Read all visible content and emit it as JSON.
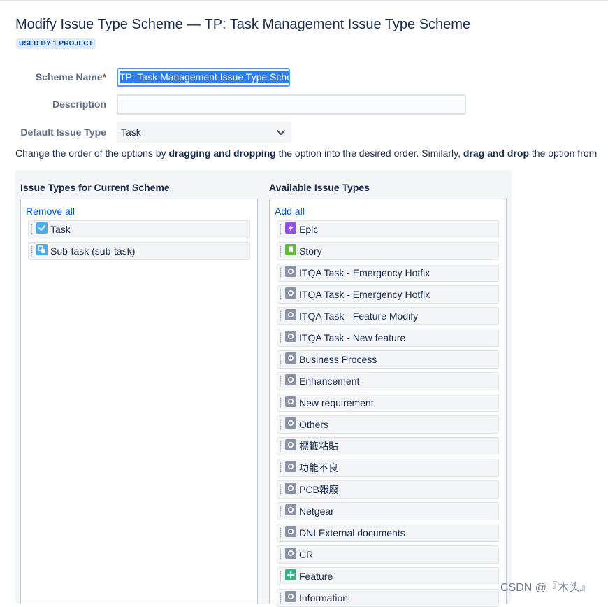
{
  "header": {
    "title": "Modify Issue Type Scheme — TP: Task Management Issue Type Scheme",
    "badge": "USED BY 1 PROJECT"
  },
  "form": {
    "scheme_name_label": "Scheme Name",
    "required_marker": "*",
    "scheme_name_value": "TP: Task Management Issue Type Scher",
    "description_label": "Description",
    "description_value": "",
    "default_issue_type_label": "Default Issue Type",
    "default_issue_type_value": "Task"
  },
  "help": {
    "t1": "Change the order of the options by ",
    "b1": "dragging and dropping",
    "t2": " the option into the desired order. Similarly, ",
    "b2": "drag and drop",
    "t3": " the option from"
  },
  "current": {
    "heading": "Issue Types for Current Scheme",
    "action": "Remove all",
    "items": [
      {
        "label": "Task",
        "icon": "task-icon",
        "color": "#4bade8"
      },
      {
        "label": "Sub-task (sub-task)",
        "icon": "subtask-icon",
        "color": "#4bade8"
      }
    ]
  },
  "available": {
    "heading": "Available Issue Types",
    "action": "Add all",
    "items": [
      {
        "label": "Epic",
        "icon": "epic-icon",
        "color": "#904ee2"
      },
      {
        "label": "Story",
        "icon": "story-icon",
        "color": "#63ba3c"
      },
      {
        "label": "ITQA Task - Emergency Hotfix",
        "icon": "generic-issue-icon",
        "color": "#8993a4"
      },
      {
        "label": "ITQA Task - Emergency Hotfix",
        "icon": "generic-issue-icon",
        "color": "#8993a4"
      },
      {
        "label": "ITQA Task - Feature Modify",
        "icon": "generic-issue-icon",
        "color": "#8993a4"
      },
      {
        "label": "ITQA Task - New feature",
        "icon": "generic-issue-icon",
        "color": "#8993a4"
      },
      {
        "label": "Business Process",
        "icon": "generic-issue-icon",
        "color": "#8993a4"
      },
      {
        "label": "Enhancement",
        "icon": "generic-issue-icon",
        "color": "#8993a4"
      },
      {
        "label": "New requirement",
        "icon": "generic-issue-icon",
        "color": "#8993a4"
      },
      {
        "label": "Others",
        "icon": "generic-issue-icon",
        "color": "#8993a4"
      },
      {
        "label": "標籤粘貼",
        "icon": "generic-issue-icon",
        "color": "#8993a4"
      },
      {
        "label": "功能不良",
        "icon": "generic-issue-icon",
        "color": "#8993a4"
      },
      {
        "label": "PCB報廢",
        "icon": "generic-issue-icon",
        "color": "#8993a4"
      },
      {
        "label": "Netgear",
        "icon": "generic-issue-icon",
        "color": "#8993a4"
      },
      {
        "label": "DNI External documents",
        "icon": "generic-issue-icon",
        "color": "#8993a4"
      },
      {
        "label": "CR",
        "icon": "generic-issue-icon",
        "color": "#8993a4"
      },
      {
        "label": "Feature",
        "icon": "new-feature-icon",
        "color": "#36b37e"
      },
      {
        "label": "Information",
        "icon": "generic-issue-icon",
        "color": "#8993a4"
      }
    ]
  },
  "watermark": "CSDN @『木头』"
}
